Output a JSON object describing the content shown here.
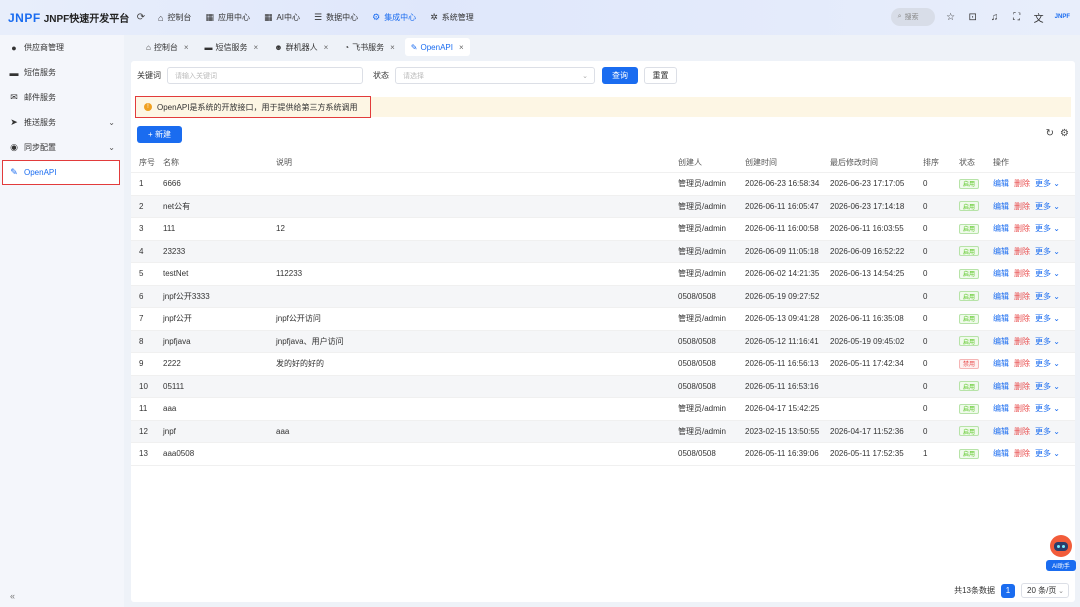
{
  "app": {
    "logo_mark": "JNPF",
    "title": "JNPF快速开发平台",
    "refresh_icon": "C"
  },
  "topnav": [
    {
      "label": "控制台",
      "icon": "home-icon"
    },
    {
      "label": "应用中心",
      "icon": "app-icon"
    },
    {
      "label": "AI中心",
      "icon": "ai-icon"
    },
    {
      "label": "数据中心",
      "icon": "data-icon"
    },
    {
      "label": "集成中心",
      "icon": "integration-icon",
      "active": true
    },
    {
      "label": "系统管理",
      "icon": "gear-icon"
    }
  ],
  "topright": {
    "search_placeholder": "搜索",
    "brand_small": "JNPF"
  },
  "sidebar": {
    "items": [
      {
        "label": "供应商管理",
        "icon": "user-icon"
      },
      {
        "label": "短信服务",
        "icon": "message-icon"
      },
      {
        "label": "邮件服务",
        "icon": "mail-icon"
      },
      {
        "label": "推送服务",
        "icon": "send-icon",
        "expandable": true
      },
      {
        "label": "同步配置",
        "icon": "sync-icon",
        "expandable": true
      },
      {
        "label": "OpenAPI",
        "icon": "api-icon",
        "active": true
      }
    ],
    "collapse_label": "«"
  },
  "tabs": [
    {
      "label": "控制台"
    },
    {
      "label": "短信服务"
    },
    {
      "label": "群机器人"
    },
    {
      "label": "飞书服务"
    },
    {
      "label": "OpenAPI",
      "active": true
    }
  ],
  "filter": {
    "keyword_label": "关键词",
    "keyword_placeholder": "请输入关键词",
    "status_label": "状态",
    "status_placeholder": "请选择",
    "search_button": "查询",
    "reset_button": "重置"
  },
  "notice": "OpenAPI是系统的开放接口，用于提供给第三方系统调用",
  "new_button": "+ 新建",
  "table": {
    "headers": [
      "序号",
      "名称",
      "说明",
      "创建人",
      "创建时间",
      "最后修改时间",
      "排序",
      "状态",
      "操作"
    ],
    "op_edit": "编辑",
    "op_delete": "删除",
    "op_more": "更多",
    "rows": [
      {
        "idx": "1",
        "name": "6666",
        "desc": "",
        "creator": "管理员/admin",
        "ctime": "2026-06-23 16:58:34",
        "mtime": "2026-06-23 17:17:05",
        "sort": "0",
        "status": "启用"
      },
      {
        "idx": "2",
        "name": "net公有",
        "desc": "",
        "creator": "管理员/admin",
        "ctime": "2026-06-11 16:05:47",
        "mtime": "2026-06-23 17:14:18",
        "sort": "0",
        "status": "启用"
      },
      {
        "idx": "3",
        "name": "111",
        "desc": "12",
        "creator": "管理员/admin",
        "ctime": "2026-06-11 16:00:58",
        "mtime": "2026-06-11 16:03:55",
        "sort": "0",
        "status": "启用"
      },
      {
        "idx": "4",
        "name": "23233",
        "desc": "",
        "creator": "管理员/admin",
        "ctime": "2026-06-09 11:05:18",
        "mtime": "2026-06-09 16:52:22",
        "sort": "0",
        "status": "启用"
      },
      {
        "idx": "5",
        "name": "testNet",
        "desc": "112233",
        "creator": "管理员/admin",
        "ctime": "2026-06-02 14:21:35",
        "mtime": "2026-06-13 14:54:25",
        "sort": "0",
        "status": "启用"
      },
      {
        "idx": "6",
        "name": "jnpf公开3333",
        "desc": "",
        "creator": "0508/0508",
        "ctime": "2026-05-19 09:27:52",
        "mtime": "",
        "sort": "0",
        "status": "启用"
      },
      {
        "idx": "7",
        "name": "jnpf公开",
        "desc": "jnpf公开访问",
        "creator": "管理员/admin",
        "ctime": "2026-05-13 09:41:28",
        "mtime": "2026-06-11 16:35:08",
        "sort": "0",
        "status": "启用"
      },
      {
        "idx": "8",
        "name": "jnpfjava",
        "desc": "jnpfjava、用户访问",
        "creator": "0508/0508",
        "ctime": "2026-05-12 11:16:41",
        "mtime": "2026-05-19 09:45:02",
        "sort": "0",
        "status": "启用"
      },
      {
        "idx": "9",
        "name": "2222",
        "desc": "发的好的好的",
        "creator": "0508/0508",
        "ctime": "2026-05-11 16:56:13",
        "mtime": "2026-05-11 17:42:34",
        "sort": "0",
        "status": "禁用"
      },
      {
        "idx": "10",
        "name": "05111",
        "desc": "",
        "creator": "0508/0508",
        "ctime": "2026-05-11 16:53:16",
        "mtime": "",
        "sort": "0",
        "status": "启用"
      },
      {
        "idx": "11",
        "name": "aaa",
        "desc": "",
        "creator": "管理员/admin",
        "ctime": "2026-04-17 15:42:25",
        "mtime": "",
        "sort": "0",
        "status": "启用"
      },
      {
        "idx": "12",
        "name": "jnpf",
        "desc": "aaa",
        "creator": "管理员/admin",
        "ctime": "2023-02-15 13:50:55",
        "mtime": "2026-04-17 11:52:36",
        "sort": "0",
        "status": "启用"
      },
      {
        "idx": "13",
        "name": "aaa0508",
        "desc": "",
        "creator": "0508/0508",
        "ctime": "2026-05-11 16:39:06",
        "mtime": "2026-05-11 17:52:35",
        "sort": "1",
        "status": "启用"
      }
    ]
  },
  "footer": {
    "total": "共13条数据",
    "current_page": "1",
    "page_size": "20 条/页"
  },
  "ai_assistant": "AI助手"
}
